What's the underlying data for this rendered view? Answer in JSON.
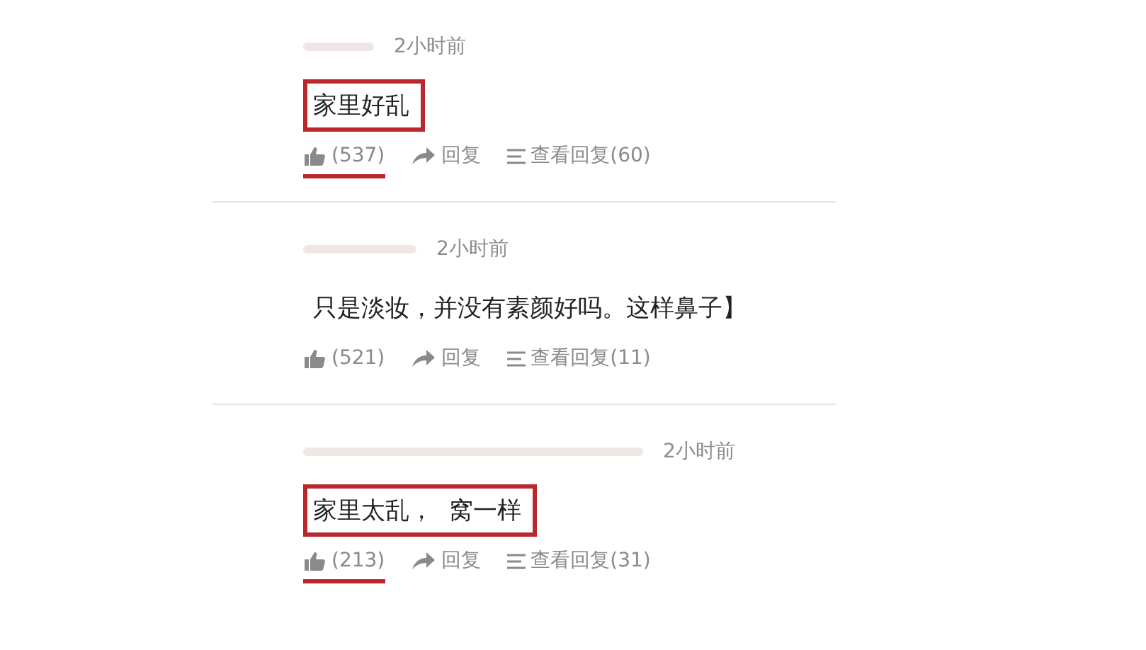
{
  "comments": [
    {
      "time": "2小时前",
      "text": "家里好乱",
      "highlighted": true,
      "likes": "(537)",
      "reply": "回复",
      "view_replies": "查看回复(60)"
    },
    {
      "time": "2小时前",
      "text": "只是淡妆，并没有素颜好吗。这样鼻子】",
      "highlighted": false,
      "likes": "(521)",
      "reply": "回复",
      "view_replies": "查看回复(11)"
    },
    {
      "time": "2小时前",
      "text": "家里太乱，  窝一样",
      "highlighted": true,
      "likes": "(213)",
      "reply": "回复",
      "view_replies": "查看回复(31)"
    }
  ]
}
